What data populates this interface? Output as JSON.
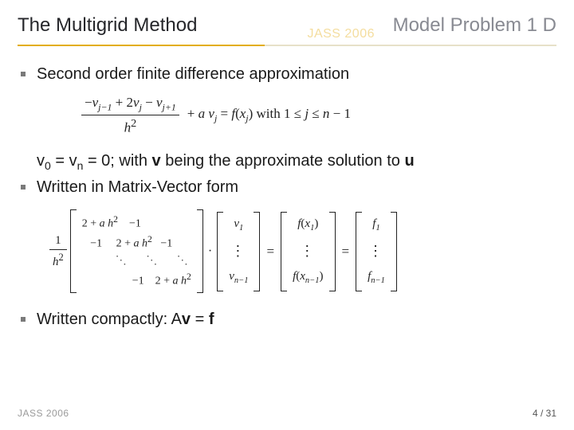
{
  "header": {
    "title_left": "The Multigrid Method",
    "title_right": "Model Problem 1 D",
    "watermark": "JASS 2006"
  },
  "body": {
    "bullet1": "Second order finite difference approximation",
    "eq1": {
      "frac_num_html": "−<i>v</i><sub>j−1</sub> + 2<i>v</i><sub>j</sub> − <i>v</i><sub>j+1</sub>",
      "frac_den_html": "<i>h</i><sup>2</sup>",
      "rest_html": " + <i>a v</i><sub>j</sub> = <i>f</i>(<i>x</i><sub>j</sub>) with 1 ≤ <i>j</i> ≤ <i>n</i> − 1"
    },
    "line_v0_html": "v<sub style='font-style:normal'>0</sub> = v<sub style='font-style:normal'>n</sub> = 0; with <b>v</b> being the approximate solution to <b>u</b>",
    "bullet2": "Written in Matrix-Vector form",
    "matrix": {
      "coef_num": "1",
      "coef_den_html": "<i>h</i><sup>2</sup>",
      "tri_top_html": "2 + <i>a h</i><sup>2</sup>    −1",
      "tri_mid1_html": "   −1     2 + <i>a h</i><sup>2</sup>   −1",
      "tri_dots": "            ⋱       ⋱       ⋱",
      "tri_bot_html": "                  −1    2 + <i>a h</i><sup>2</sup>",
      "dot": "·",
      "vec_v_top_html": "<i>v</i><sub>1</sub>",
      "vec_v_dots": "⋮",
      "vec_v_bot_html": "<i>v</i><sub>n−1</sub>",
      "eq": "=",
      "vec_fx_top_html": "<i>f</i>(<i>x</i><sub>1</sub>)",
      "vec_fx_bot_html": "<i>f</i>(<i>x</i><sub>n−1</sub>)",
      "vec_f_top_html": "<i>f</i><sub>1</sub>",
      "vec_f_bot_html": "<i>f</i><sub>n−1</sub>"
    },
    "bullet3_html": "Written compactly: A<b>v</b> = <b>f</b>"
  },
  "footer": {
    "left": "JASS 2006",
    "page": "4 / 31"
  }
}
